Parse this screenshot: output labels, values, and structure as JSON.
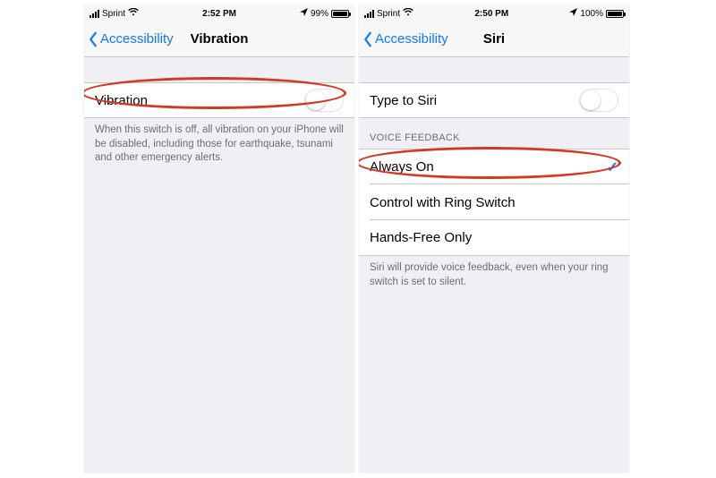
{
  "left": {
    "status": {
      "carrier": "Sprint",
      "time": "2:52 PM",
      "battery_text": "99%"
    },
    "nav": {
      "back": "Accessibility",
      "title": "Vibration"
    },
    "row_label": "Vibration",
    "footer": "When this switch is off, all vibration on your iPhone will be disabled, including those for earthquake, tsunami and other emergency alerts."
  },
  "right": {
    "status": {
      "carrier": "Sprint",
      "time": "2:50 PM",
      "battery_text": "100%"
    },
    "nav": {
      "back": "Accessibility",
      "title": "Siri"
    },
    "type_row": "Type to Siri",
    "section": "VOICE FEEDBACK",
    "options": [
      "Always On",
      "Control with Ring Switch",
      "Hands-Free Only"
    ],
    "footer": "Siri will provide voice feedback, even when your ring switch is set to silent."
  }
}
